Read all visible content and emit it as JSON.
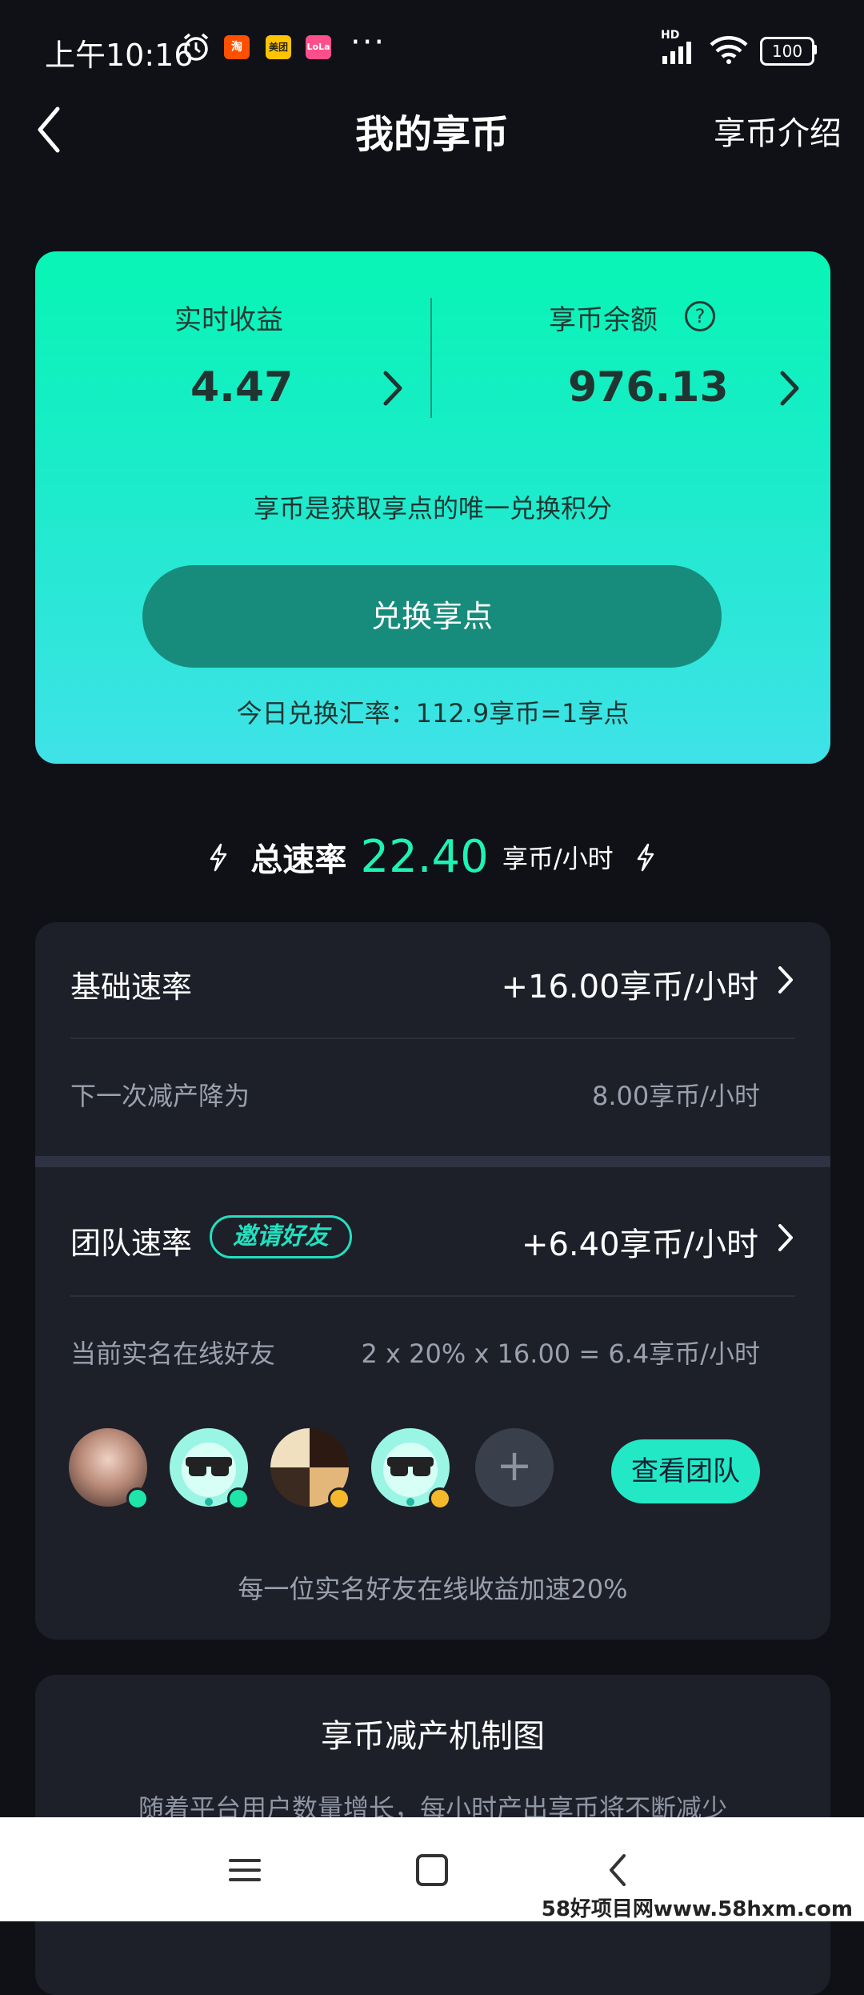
{
  "status_bar": {
    "time": "上午10:16",
    "apps": [
      {
        "name": "taobao-icon",
        "text": "淘",
        "color": "#ff5000"
      },
      {
        "name": "meituan-icon",
        "text": "美团",
        "color": "#ffc300"
      },
      {
        "name": "lofter-icon",
        "text": "LoLa",
        "color": "#ff4f8b"
      }
    ],
    "more": "···",
    "network": "HD",
    "battery": "100"
  },
  "header": {
    "title": "我的享币",
    "right_link": "享币介绍"
  },
  "balance_card": {
    "realtime_label": "实时收益",
    "realtime_value": "4.47",
    "balance_label": "享币余额",
    "balance_value": "976.13",
    "help_glyph": "?",
    "description": "享币是获取享点的唯一兑换积分",
    "exchange_button": "兑换享点",
    "exchange_rate": "今日兑换汇率：112.9享币=1享点",
    "gradient_colors": [
      "#08f5b5",
      "#3fe2e8"
    ]
  },
  "total_speed": {
    "label": "总速率",
    "value": "22.40",
    "unit": "享币/小时",
    "accent_color": "#1ef2b5"
  },
  "rates": {
    "base_label": "基础速率",
    "base_value": "+16.00享币/小时",
    "next_reduction_label": "下一次减产降为",
    "next_reduction_value": "8.00享币/小时",
    "team_label": "团队速率",
    "invite_badge": "邀请好友",
    "team_value": "+6.40享币/小时",
    "online_friends_label": "当前实名在线好友",
    "online_friends_formula": "2 x 20% x 16.00 = 6.4享币/小时",
    "add_glyph": "+",
    "view_team_button": "查看团队",
    "tip": "每一位实名好友在线收益加速20%",
    "friend_status_colors": [
      "#1ee6a8",
      "#1ee6a8",
      "#f5b82a",
      "#f5b82a"
    ]
  },
  "mechanism": {
    "title": "享币减产机制图",
    "subtitle": "随着平台用户数量增长，每小时产出享币将不断减少"
  },
  "watermark": "58好项目网www.58hxm.com"
}
